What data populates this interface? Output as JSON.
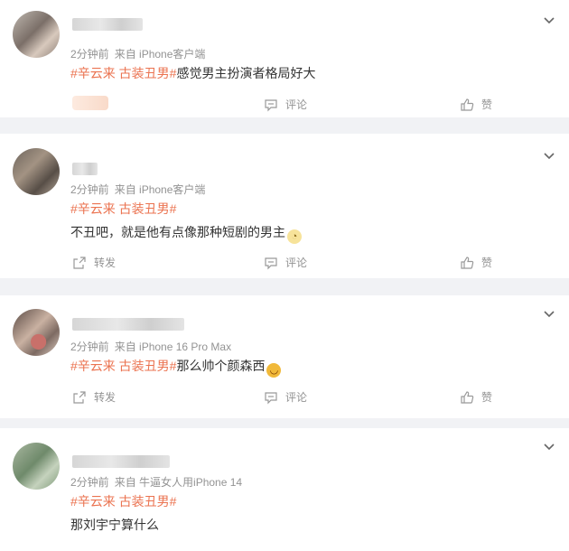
{
  "posts": [
    {
      "time": "2分钟前",
      "source": "来自 iPhone客户端",
      "tags": "#辛云来 古装丑男#",
      "text": "感觉男主扮演者格局好大",
      "emoji": "",
      "actions": {
        "repost": "",
        "comment": "评论",
        "like": "赞"
      }
    },
    {
      "time": "2分钟前",
      "source": "来自 iPhone客户端",
      "tags": "#辛云来 古装丑男#",
      "text": "不丑吧，就是他有点像那种短剧的男主",
      "emoji": "smug-face-emoji",
      "actions": {
        "repost": "转发",
        "comment": "评论",
        "like": "赞"
      }
    },
    {
      "time": "2分钟前",
      "source": "来自 iPhone 16 Pro Max",
      "tags": "#辛云来 古装丑男#",
      "text": "那么帅个颜森西",
      "emoji": "laughing-face-emoji",
      "actions": {
        "repost": "转发",
        "comment": "评论",
        "like": "赞"
      }
    },
    {
      "time": "2分钟前",
      "source": "来自 牛逼女人用iPhone 14",
      "tags": "#辛云来 古装丑男#",
      "text": "那刘宇宁算什么",
      "emoji": "",
      "actions": {
        "repost": "",
        "comment": "",
        "like": ""
      }
    }
  ],
  "colors": {
    "tag": "#eb7350",
    "meta": "#939393",
    "background": "#f1f2f5"
  }
}
